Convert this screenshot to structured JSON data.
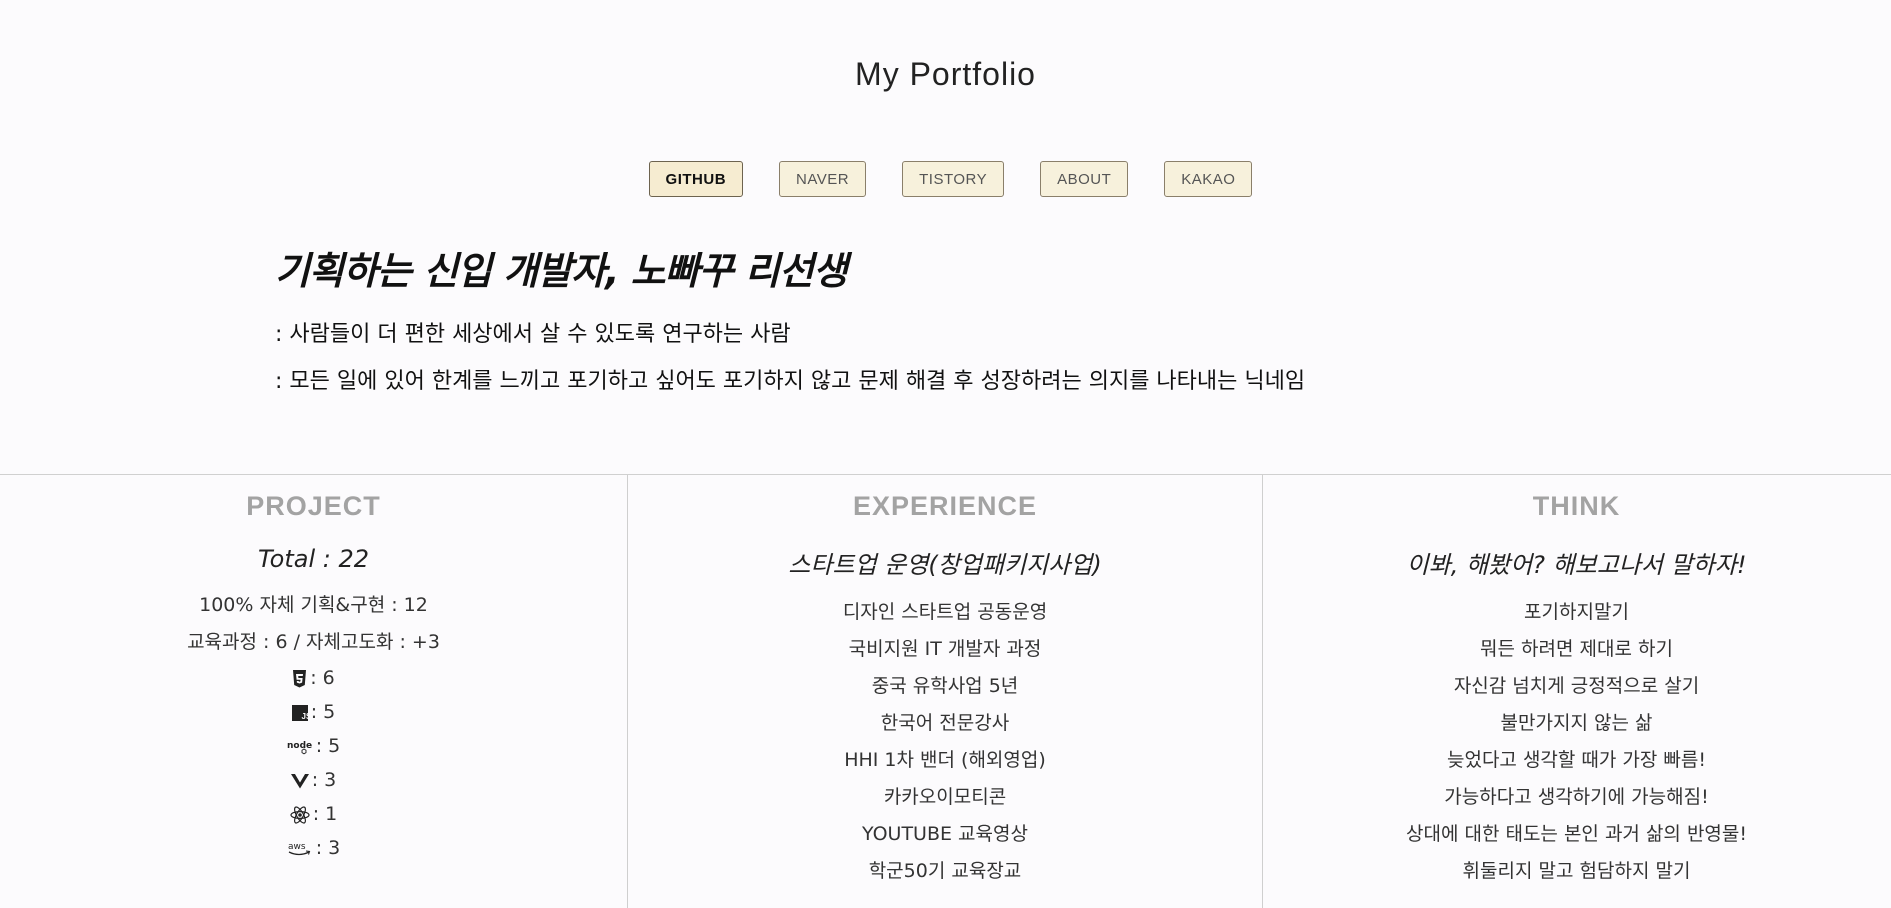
{
  "header": {
    "title": "My Portfolio",
    "nav": [
      {
        "label": "GITHUB",
        "active": true
      },
      {
        "label": "NAVER",
        "active": false
      },
      {
        "label": "TISTORY",
        "active": false
      },
      {
        "label": "ABOUT",
        "active": false
      },
      {
        "label": "KAKAO",
        "active": false
      }
    ]
  },
  "intro": {
    "headline": "기획하는 신입 개발자, 노빠꾸 리선생",
    "lines": [
      ": 사람들이 더 편한 세상에서 살 수 있도록 연구하는 사람",
      ": 모든 일에 있어 한계를 느끼고 포기하고 싶어도 포기하지 않고 문제 해결 후 성장하려는 의지를 나타내는 닉네임"
    ]
  },
  "project": {
    "heading": "PROJECT",
    "total": "Total : 22",
    "stats": [
      "100% 자체 기획&구현 : 12",
      "교육과정 : 6 / 자체고도화 : +3"
    ],
    "tech": [
      {
        "icon": "html5-icon",
        "value": ": 6"
      },
      {
        "icon": "javascript-icon",
        "value": ": 5"
      },
      {
        "icon": "nodejs-icon",
        "value": ": 5"
      },
      {
        "icon": "vue-icon",
        "value": ": 3"
      },
      {
        "icon": "react-icon",
        "value": ": 1"
      },
      {
        "icon": "aws-icon",
        "value": ": 3"
      }
    ]
  },
  "experience": {
    "heading": "EXPERIENCE",
    "subtitle": "스타트업 운영(창업패키지사업)",
    "items": [
      "디자인 스타트업 공동운영",
      "국비지원 IT 개발자 과정",
      "중국 유학사업 5년",
      "한국어 전문강사",
      "HHI 1차 밴더 (해외영업)",
      "카카오이모티콘",
      "YOUTUBE 교육영상",
      "학군50기 교육장교"
    ]
  },
  "think": {
    "heading": "THINK",
    "subtitle": "이봐, 해봤어? 해보고나서 말하자!",
    "items": [
      "포기하지말기",
      "뭐든 하려면 제대로 하기",
      "자신감 넘치게 긍정적으로 살기",
      "불만가지지 않는 삶",
      "늦었다고 생각할 때가 가장 빠름!",
      "가능하다고 생각하기에 가능해짐!",
      "상대에 대한 태도는 본인 과거 삶의 반영물!",
      "휘둘리지 말고 험담하지 말기"
    ]
  }
}
